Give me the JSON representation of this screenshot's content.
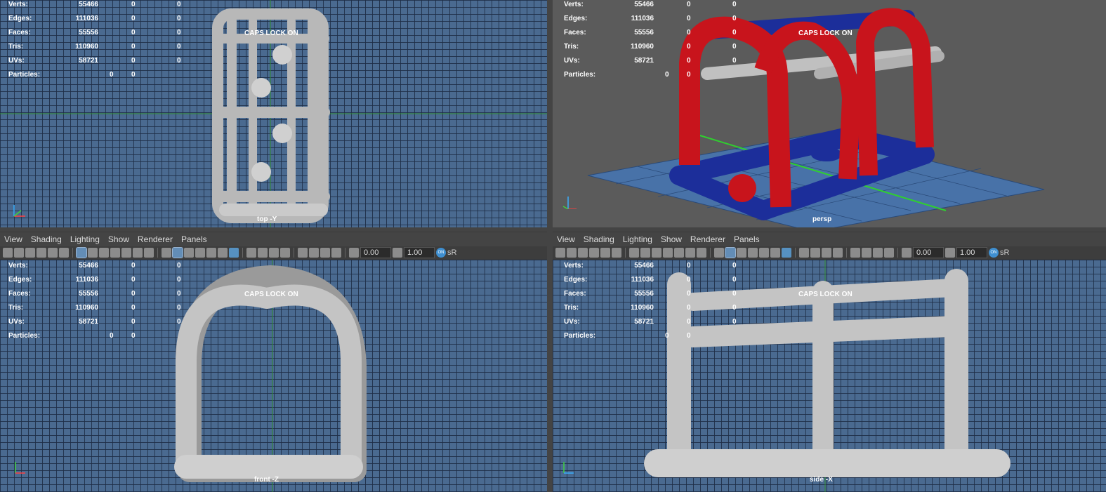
{
  "hud": {
    "rows": [
      {
        "label": "Verts:",
        "total": "55466",
        "sel": "0",
        "extra": "0"
      },
      {
        "label": "Edges:",
        "total": "111036",
        "sel": "0",
        "extra": "0"
      },
      {
        "label": "Faces:",
        "total": "55556",
        "sel": "0",
        "extra": "0"
      },
      {
        "label": "Tris:",
        "total": "110960",
        "sel": "0",
        "extra": "0"
      },
      {
        "label": "UVs:",
        "total": "58721",
        "sel": "0",
        "extra": "0"
      },
      {
        "label": "Particles:",
        "total": "0",
        "sel": "0",
        "extra": ""
      }
    ]
  },
  "caps_lock": "CAPS LOCK ON",
  "viewports": {
    "top": {
      "camera": "top -Y"
    },
    "persp": {
      "camera": "persp"
    },
    "front": {
      "camera": "front -Z"
    },
    "side": {
      "camera": "side -X"
    }
  },
  "menu": {
    "view": "View",
    "shading": "Shading",
    "lighting": "Lighting",
    "show": "Show",
    "renderer": "Renderer",
    "panels": "Panels"
  },
  "toolbar": {
    "exposure": "0.00",
    "gamma": "1.00",
    "color_mgmt": "sR",
    "on": "ON"
  },
  "colors": {
    "grid_bg": "#4a6a90",
    "persp_bg": "#5b5b5b",
    "red": "#c8141c",
    "blue": "#1c2e9a",
    "grey": "#c0c0c0"
  }
}
